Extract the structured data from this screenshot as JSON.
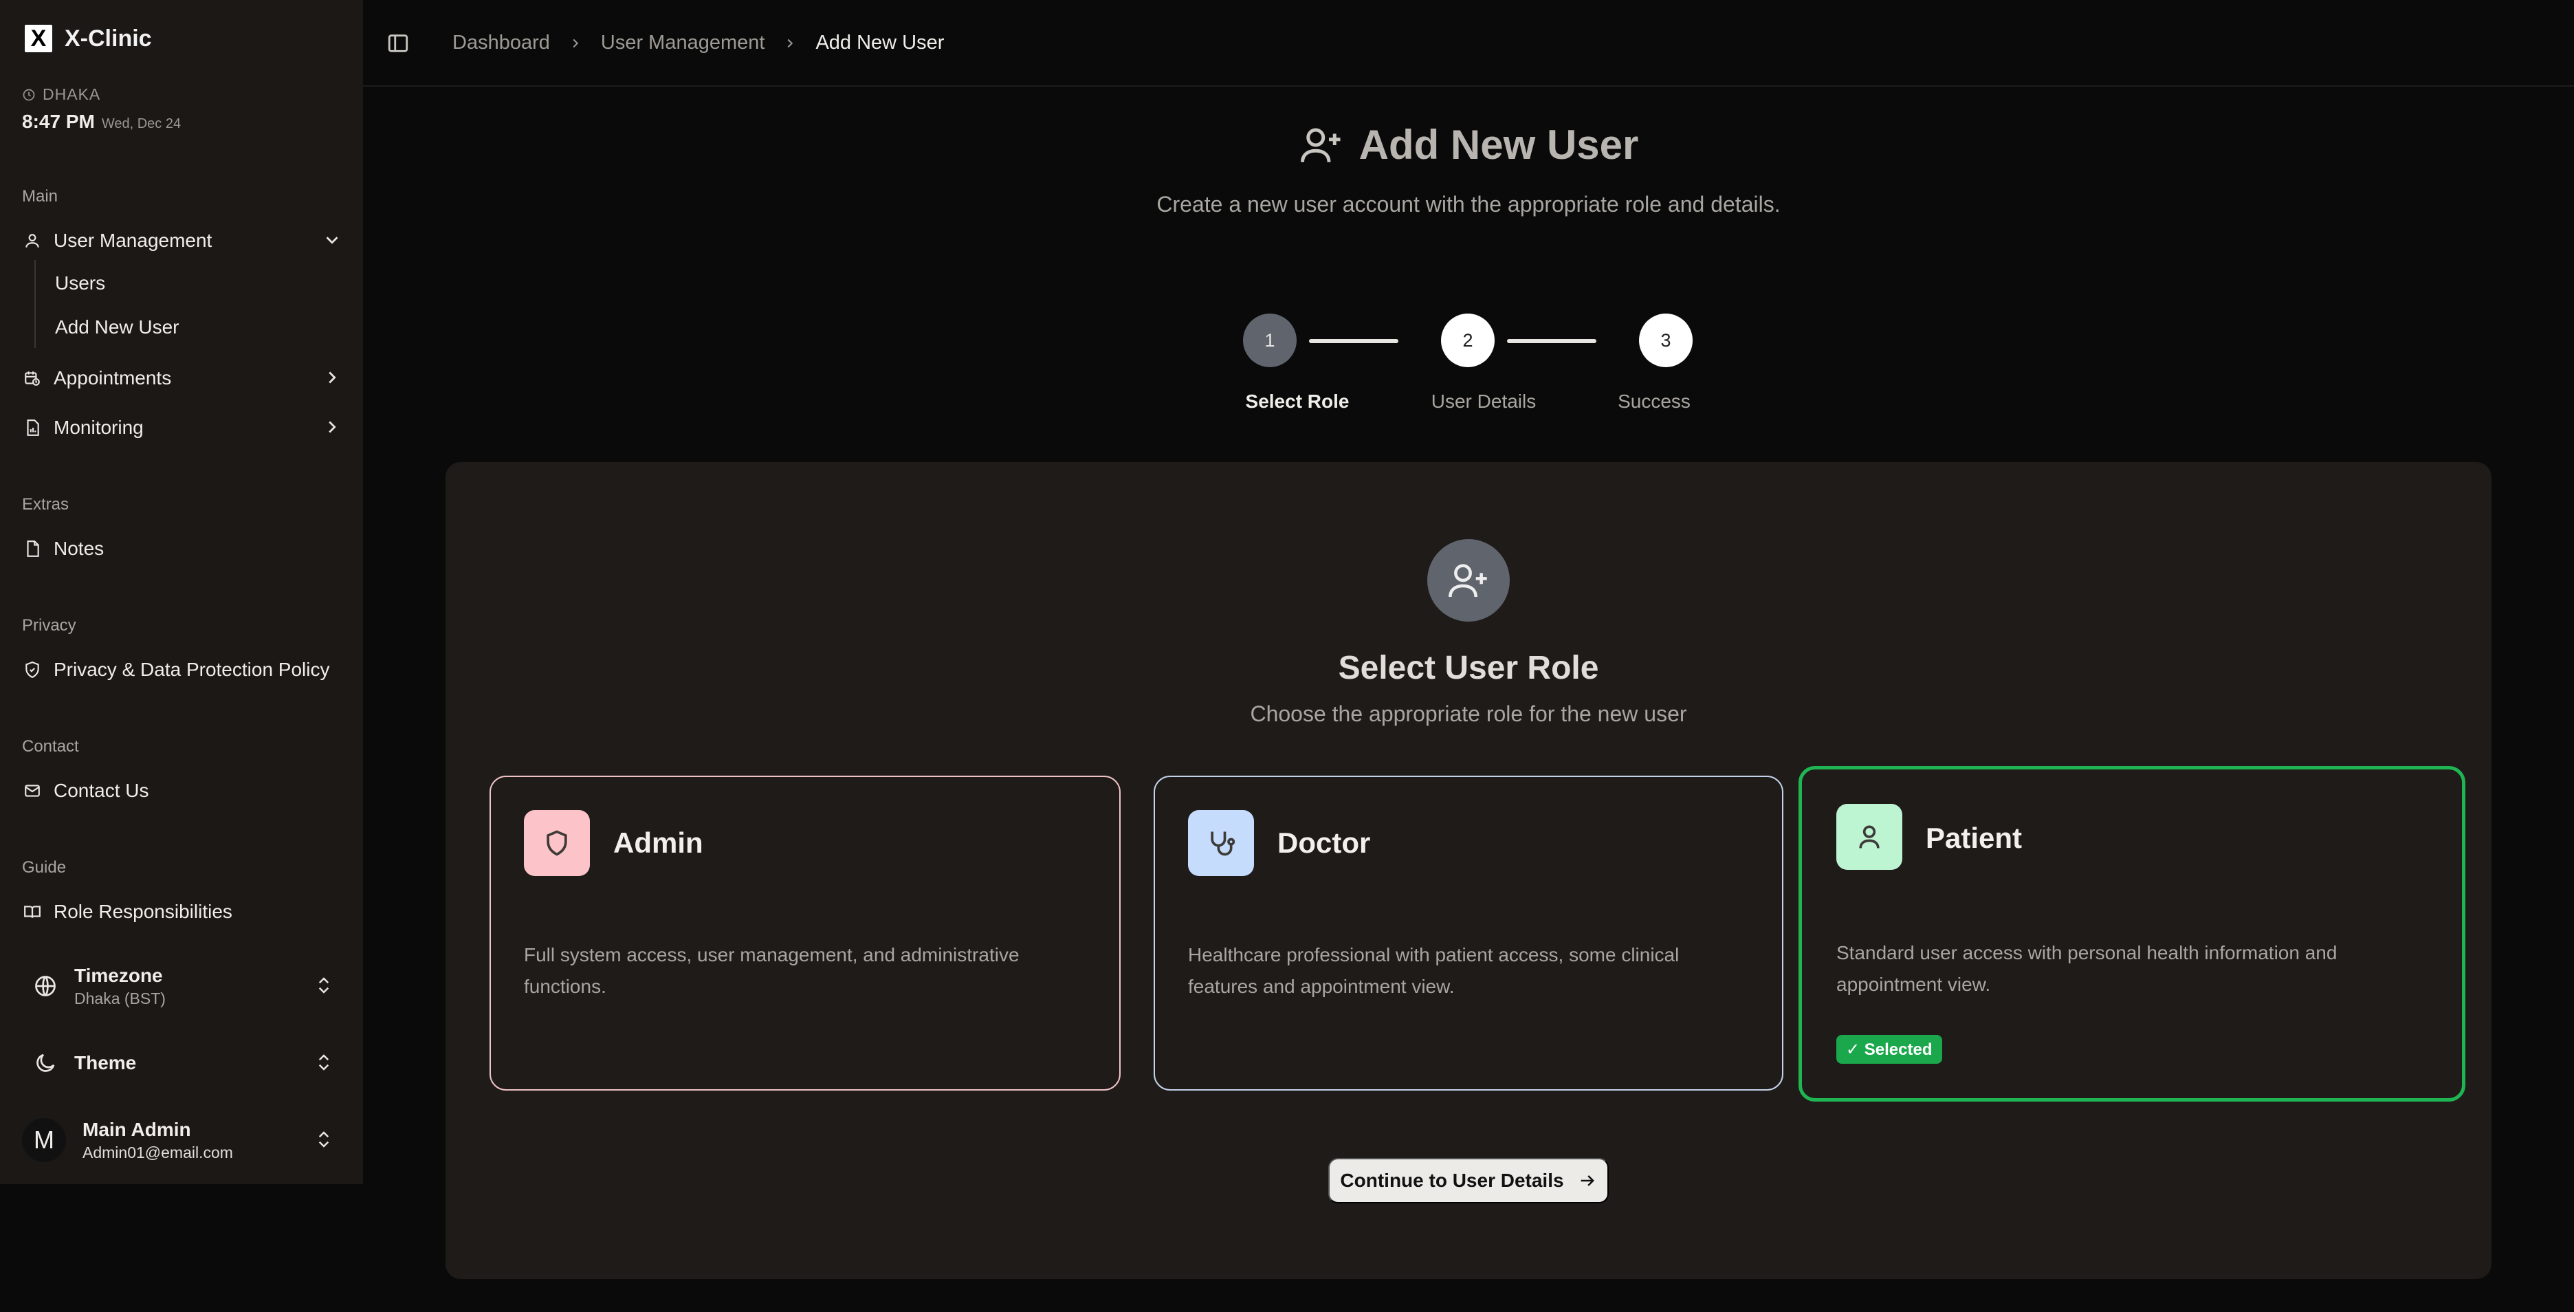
{
  "brand": {
    "name": "X-Clinic",
    "logo_letter": "X"
  },
  "clock": {
    "city": "DHAKA",
    "time": "8:47 PM",
    "date": "Wed, Dec 24"
  },
  "sidebar": {
    "section_main": "Main",
    "user_management": "User Management",
    "users": "Users",
    "add_new_user": "Add New User",
    "appointments": "Appointments",
    "monitoring": "Monitoring",
    "section_extras": "Extras",
    "notes": "Notes",
    "section_privacy": "Privacy",
    "privacy_policy": "Privacy & Data Protection Policy",
    "section_contact": "Contact",
    "contact_us": "Contact Us",
    "section_guide": "Guide",
    "role_responsibilities": "Role Responsibilities",
    "timezone_title": "Timezone",
    "timezone_value": "Dhaka (BST)",
    "theme_title": "Theme",
    "user_initial": "M",
    "user_name": "Main Admin",
    "user_email": "Admin01@email.com"
  },
  "breadcrumb": {
    "item1": "Dashboard",
    "item2": "User Management",
    "current": "Add New User"
  },
  "header": {
    "title": "Add New User",
    "subtitle": "Create a new user account with the appropriate role and details."
  },
  "stepper": {
    "steps": [
      {
        "number": "1",
        "label": "Select Role",
        "state": "active"
      },
      {
        "number": "2",
        "label": "User Details",
        "state": "pending"
      },
      {
        "number": "3",
        "label": "Success",
        "state": "pending"
      }
    ]
  },
  "role_section": {
    "title": "Select User Role",
    "subtitle": "Choose the appropriate role for the new user",
    "roles": [
      {
        "name": "Admin",
        "description": "Full system access, user management, and administrative functions.",
        "icon": "shield-icon",
        "accent": "#fcc4c8"
      },
      {
        "name": "Doctor",
        "description": "Healthcare professional with patient access, some clinical features and appointment view.",
        "icon": "stethoscope-icon",
        "accent": "#c6dcfd"
      },
      {
        "name": "Patient",
        "description": "Standard user access with personal health information and appointment view.",
        "icon": "user-icon",
        "accent": "#bdf5d3",
        "selected": true
      }
    ],
    "selected_badge": "✓ Selected"
  },
  "continue_button": "Continue to User Details",
  "colors": {
    "selected_border": "#1fb553",
    "badge_green": "#1ba84c",
    "active_step": "#5f646d"
  }
}
